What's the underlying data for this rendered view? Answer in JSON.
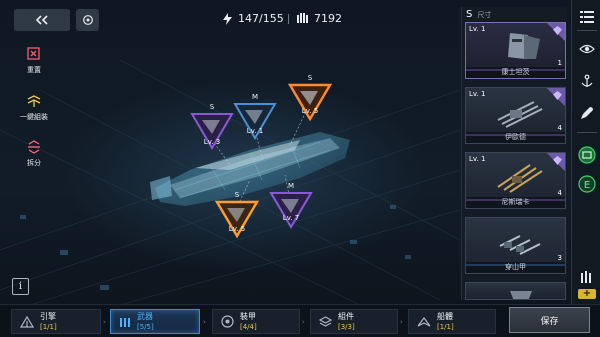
{
  "header": {
    "energy": "147/155",
    "count": "7192"
  },
  "actions": [
    {
      "label": "重置",
      "icon": "reset-icon"
    },
    {
      "label": "一鍵組裝",
      "icon": "auto-assemble-icon"
    },
    {
      "label": "拆分",
      "icon": "split-icon"
    }
  ],
  "slots": [
    {
      "size": "S",
      "level": "Lv. 3",
      "color": "#8a5ad6"
    },
    {
      "size": "M",
      "level": "Lv. 1",
      "color": "#4d8fd1"
    },
    {
      "size": "S",
      "level": "Lv. 5",
      "color": "#ff8a2a"
    },
    {
      "size": "S",
      "level": "Lv. 5",
      "color": "#ff9d2e"
    },
    {
      "size": "M",
      "level": "Lv. 7",
      "color": "#8a5ad6"
    }
  ],
  "panel": {
    "size_label": "S",
    "size_sub": "尺寸",
    "cards": [
      {
        "level": "Lv. 1",
        "qty": "1",
        "name": "康士坦茨"
      },
      {
        "level": "Lv. 1",
        "qty": "4",
        "name": "伊歐德"
      },
      {
        "level": "Lv. 1",
        "qty": "4",
        "name": "尼斯瑞卡"
      },
      {
        "level": "",
        "qty": "3",
        "name": "穿山甲"
      }
    ]
  },
  "tabs": [
    {
      "name": "引擎",
      "count": "[1/1]",
      "icon": "engine-icon"
    },
    {
      "name": "武器",
      "count": "[5/5]",
      "icon": "weapon-icon"
    },
    {
      "name": "裝甲",
      "count": "[4/4]",
      "icon": "armor-icon"
    },
    {
      "name": "組件",
      "count": "[3/3]",
      "icon": "component-icon"
    },
    {
      "name": "船體",
      "count": "[1/1]",
      "icon": "hull-icon"
    }
  ],
  "save_label": "保存",
  "info_label": "i",
  "colors": {
    "accent_blue": "#4fb0ff",
    "gold": "#f0c94a",
    "purple": "#8a5ad6",
    "orange": "#ff8a2a"
  }
}
